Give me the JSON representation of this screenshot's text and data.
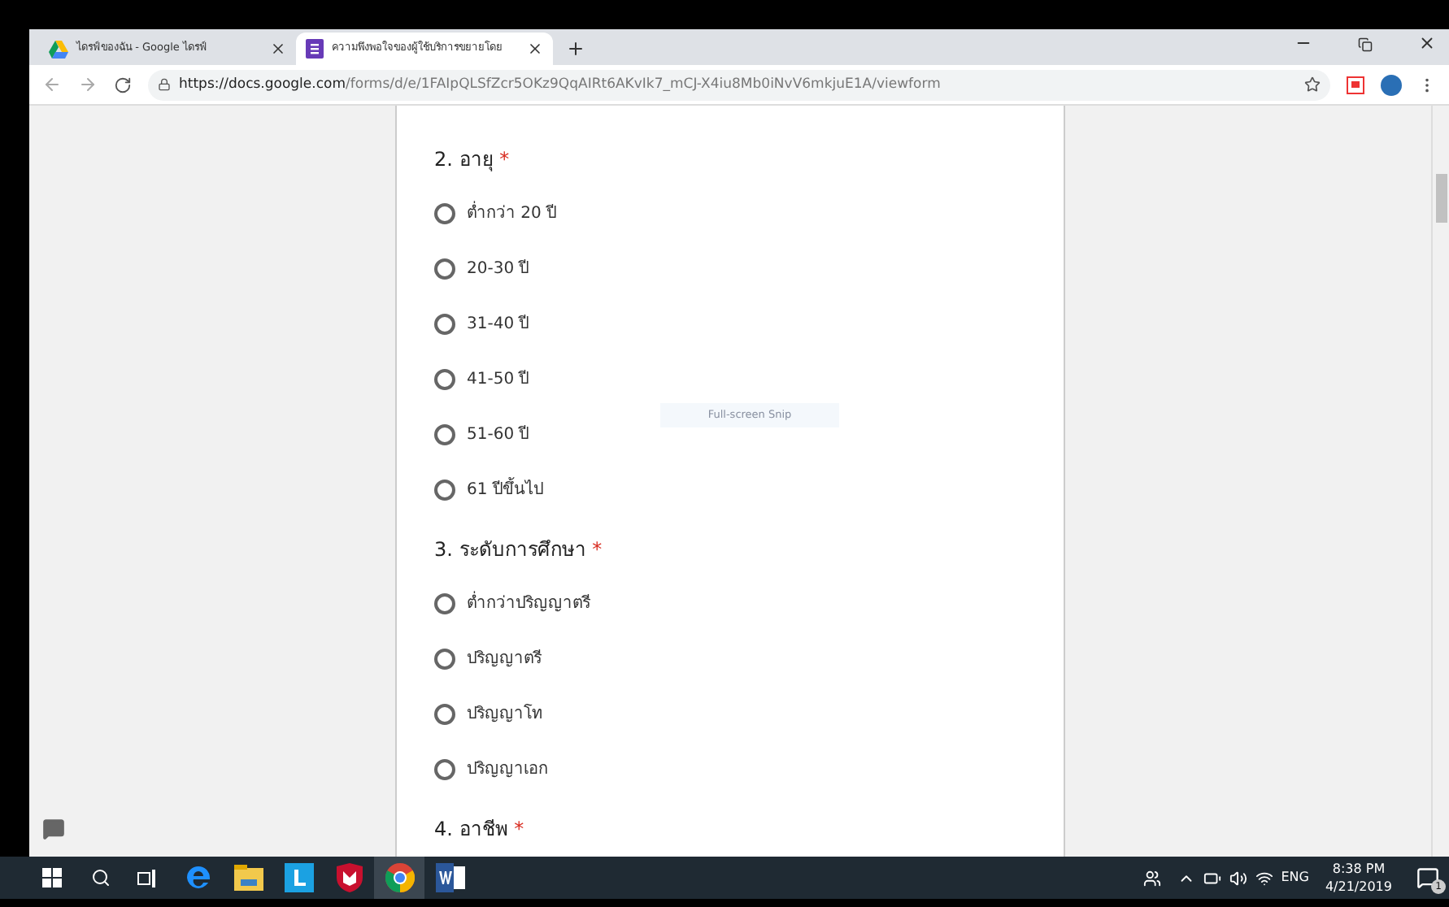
{
  "browser": {
    "tabs": [
      {
        "title": "ไดรฟ์ของฉัน - Google ไดรฟ์",
        "selected": false
      },
      {
        "title": "ความพึงพอใจของผู้ใช้บริการขยายโดย",
        "selected": true
      }
    ],
    "url_host": "https://docs.google.com",
    "url_path": "/forms/d/e/1FAIpQLSfZcr5OKz9QqAIRt6AKvIk7_mCJ-X4iu8Mb0iNvV6mkjuE1A/viewform"
  },
  "questions": [
    {
      "title": "2. อายุ",
      "required_mark": "*",
      "options": [
        {
          "label": "ต่ำกว่า 20 ปี",
          "selected": false
        },
        {
          "label": "20-30 ปี",
          "selected": false
        },
        {
          "label": "31-40 ปี",
          "selected": false
        },
        {
          "label": "41-50 ปี",
          "selected": false
        },
        {
          "label": "51-60 ปี",
          "selected": false
        },
        {
          "label": "61 ปีขึ้นไป",
          "selected": false
        }
      ]
    },
    {
      "title": "3. ระดับการศึกษา",
      "required_mark": "*",
      "options": [
        {
          "label": "ต่ำกว่าปริญญาตรี",
          "selected": false
        },
        {
          "label": "ปริญญาตรี",
          "selected": false
        },
        {
          "label": "ปริญญาโท",
          "selected": false
        },
        {
          "label": "ปริญญาเอก",
          "selected": false
        }
      ]
    },
    {
      "title": "4. อาชีพ",
      "required_mark": "*"
    }
  ],
  "snip_tooltip": "Full-screen Snip",
  "taskbar": {
    "apps": [
      {
        "kind": "edge",
        "selected": false
      },
      {
        "kind": "explorer",
        "selected": false
      },
      {
        "kind": "l",
        "selected": false
      },
      {
        "kind": "mcafee",
        "selected": false
      },
      {
        "kind": "chrome",
        "selected": true
      },
      {
        "kind": "word",
        "selected": false
      }
    ],
    "language": "ENG",
    "time": "8:38 PM",
    "date": "4/21/2019",
    "notification_count": "1"
  }
}
